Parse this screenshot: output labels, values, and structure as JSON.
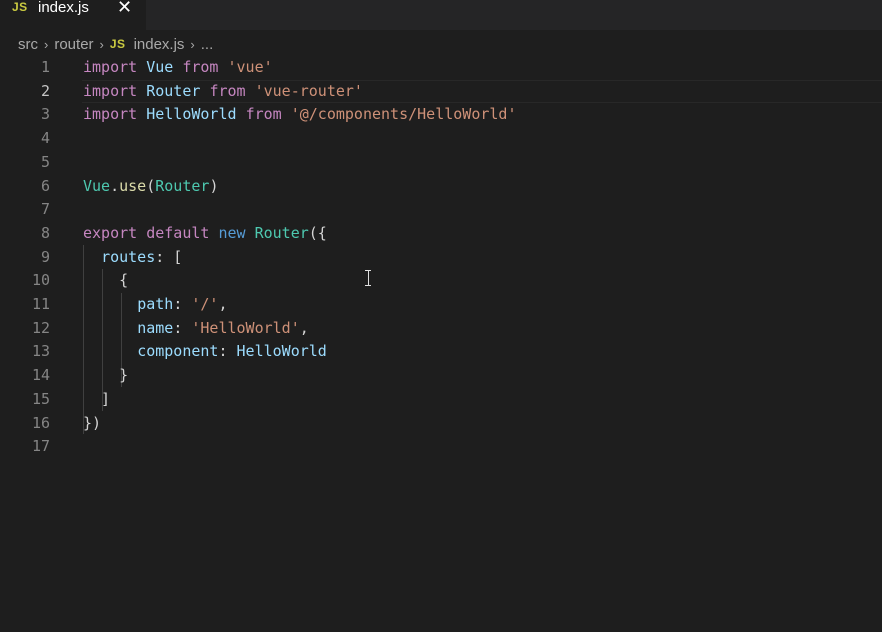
{
  "tab": {
    "badge": "JS",
    "label": "index.js",
    "close_glyph": "✕"
  },
  "breadcrumb": {
    "items": [
      "src",
      "router",
      "index.js",
      "..."
    ],
    "badge": "JS",
    "separator": "›"
  },
  "editor": {
    "line_numbers": [
      "1",
      "2",
      "3",
      "4",
      "5",
      "6",
      "7",
      "8",
      "9",
      "10",
      "11",
      "12",
      "13",
      "14",
      "15",
      "16",
      "17"
    ],
    "active_line": 2,
    "lines": [
      [
        {
          "t": "kw",
          "v": "import"
        },
        {
          "t": "plain",
          "v": " "
        },
        {
          "t": "id",
          "v": "Vue"
        },
        {
          "t": "plain",
          "v": " "
        },
        {
          "t": "kw",
          "v": "from"
        },
        {
          "t": "plain",
          "v": " "
        },
        {
          "t": "str",
          "v": "'vue'"
        }
      ],
      [
        {
          "t": "kw",
          "v": "import"
        },
        {
          "t": "plain",
          "v": " "
        },
        {
          "t": "id",
          "v": "Router"
        },
        {
          "t": "plain",
          "v": " "
        },
        {
          "t": "kw",
          "v": "from"
        },
        {
          "t": "plain",
          "v": " "
        },
        {
          "t": "str",
          "v": "'vue-router'"
        }
      ],
      [
        {
          "t": "kw",
          "v": "import"
        },
        {
          "t": "plain",
          "v": " "
        },
        {
          "t": "id",
          "v": "HelloWorld"
        },
        {
          "t": "plain",
          "v": " "
        },
        {
          "t": "kw",
          "v": "from"
        },
        {
          "t": "plain",
          "v": " "
        },
        {
          "t": "str",
          "v": "'@/components/HelloWorld'"
        }
      ],
      [],
      [],
      [
        {
          "t": "cls",
          "v": "Vue"
        },
        {
          "t": "plain",
          "v": "."
        },
        {
          "t": "fn",
          "v": "use"
        },
        {
          "t": "plain",
          "v": "("
        },
        {
          "t": "cls",
          "v": "Router"
        },
        {
          "t": "plain",
          "v": ")"
        }
      ],
      [],
      [
        {
          "t": "kw",
          "v": "export"
        },
        {
          "t": "plain",
          "v": " "
        },
        {
          "t": "kw",
          "v": "default"
        },
        {
          "t": "plain",
          "v": " "
        },
        {
          "t": "blue",
          "v": "new"
        },
        {
          "t": "plain",
          "v": " "
        },
        {
          "t": "cls",
          "v": "Router"
        },
        {
          "t": "plain",
          "v": "({"
        }
      ],
      [
        {
          "t": "plain",
          "v": "  "
        },
        {
          "t": "id",
          "v": "routes"
        },
        {
          "t": "plain",
          "v": ": ["
        }
      ],
      [
        {
          "t": "plain",
          "v": "    {"
        }
      ],
      [
        {
          "t": "plain",
          "v": "      "
        },
        {
          "t": "id",
          "v": "path"
        },
        {
          "t": "plain",
          "v": ": "
        },
        {
          "t": "str",
          "v": "'/'"
        },
        {
          "t": "plain",
          "v": ","
        }
      ],
      [
        {
          "t": "plain",
          "v": "      "
        },
        {
          "t": "id",
          "v": "name"
        },
        {
          "t": "plain",
          "v": ": "
        },
        {
          "t": "str",
          "v": "'HelloWorld'"
        },
        {
          "t": "plain",
          "v": ","
        }
      ],
      [
        {
          "t": "plain",
          "v": "      "
        },
        {
          "t": "id",
          "v": "component"
        },
        {
          "t": "plain",
          "v": ": "
        },
        {
          "t": "id",
          "v": "HelloWorld"
        }
      ],
      [
        {
          "t": "plain",
          "v": "    }"
        }
      ],
      [
        {
          "t": "plain",
          "v": "  ]"
        }
      ],
      [
        {
          "t": "plain",
          "v": "})"
        }
      ],
      []
    ]
  },
  "colors": {
    "background": "#1e1e1e",
    "keyword": "#c586c0",
    "identifier": "#9cdcfe",
    "string": "#ce9178",
    "class": "#4ec9b0",
    "function": "#dcdcaa",
    "js_badge": "#cbcb41"
  }
}
